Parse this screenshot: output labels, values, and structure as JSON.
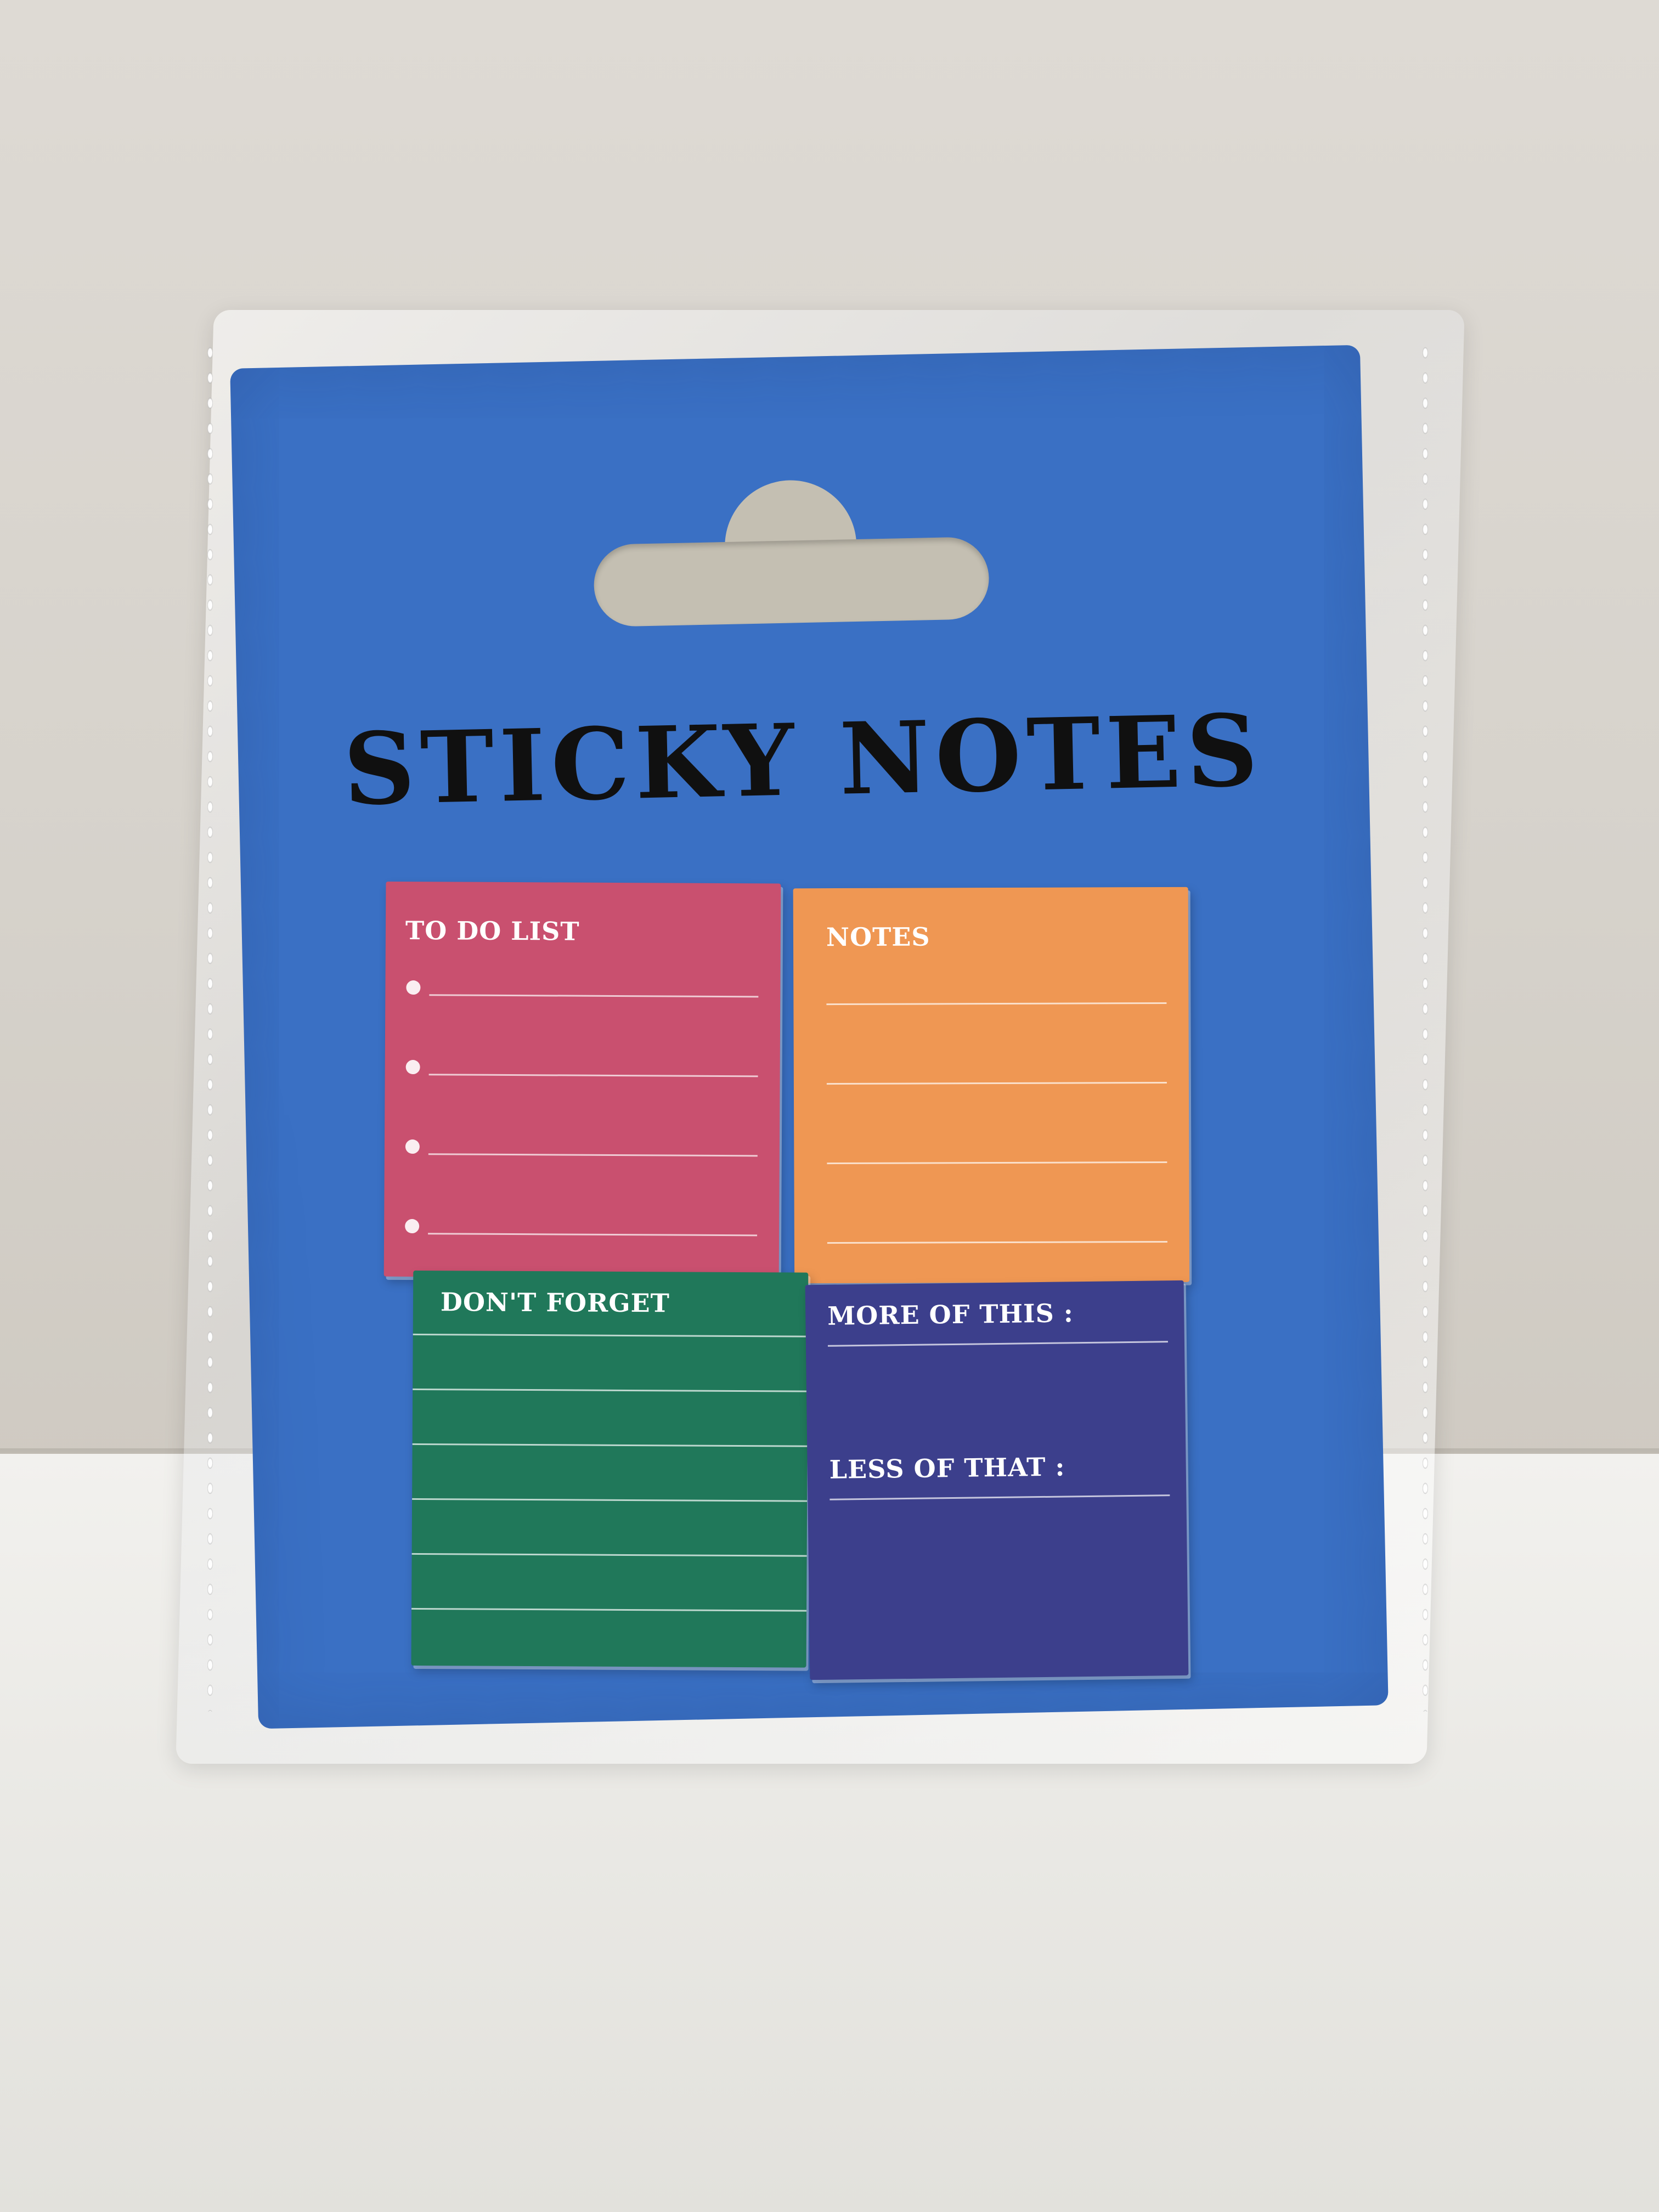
{
  "package": {
    "title": "STICKY NOTES",
    "card_color": "#3a70c4"
  },
  "notes": [
    {
      "label": "TO DO LIST",
      "color": "#c9506f"
    },
    {
      "label": "NOTES",
      "color": "#ef9753"
    },
    {
      "label": "DON'T FORGET",
      "color": "#20785a"
    },
    {
      "label": "MORE OF THIS :",
      "color": "#3c3f8c",
      "label2": "LESS OF THAT :"
    }
  ]
}
